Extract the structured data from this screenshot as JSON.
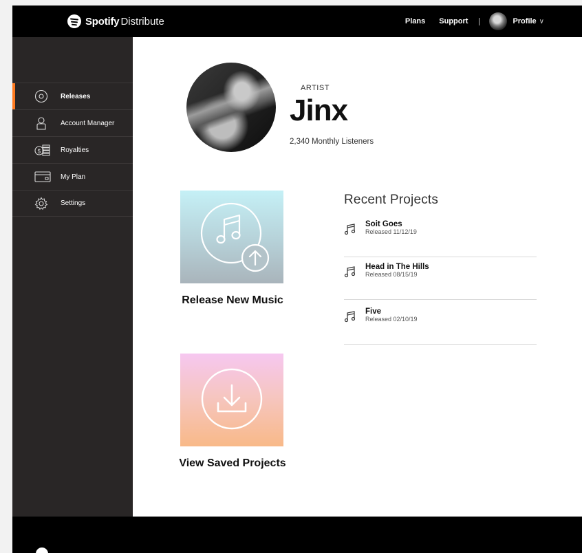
{
  "header": {
    "brand_name": "Spotify",
    "brand_product": "Distribute",
    "nav": {
      "plans": "Plans",
      "support": "Support",
      "profile": "Profile"
    }
  },
  "sidebar": {
    "items": [
      {
        "label": "Releases",
        "icon": "disc-icon",
        "active": true
      },
      {
        "label": "Account Manager",
        "icon": "user-icon",
        "active": false
      },
      {
        "label": "Royalties",
        "icon": "coins-icon",
        "active": false
      },
      {
        "label": "My Plan",
        "icon": "card-icon",
        "active": false
      },
      {
        "label": "Settings",
        "icon": "gear-icon",
        "active": false
      }
    ]
  },
  "artist": {
    "label": "ARTIST",
    "name": "Jinx",
    "listeners": "2,340 Monthly Listeners"
  },
  "actions": {
    "release_new": "Release New Music",
    "view_saved": "View Saved Projects"
  },
  "recent": {
    "title": "Recent Projects",
    "projects": [
      {
        "name": "Soit Goes",
        "date": "Released 11/12/19"
      },
      {
        "name": "Head in The Hills",
        "date": "Released 08/15/19"
      },
      {
        "name": "Five",
        "date": "Released 02/10/19"
      }
    ]
  },
  "colors": {
    "accent": "#ff7a1f",
    "sidebar": "#292626",
    "topbar": "#000000"
  }
}
